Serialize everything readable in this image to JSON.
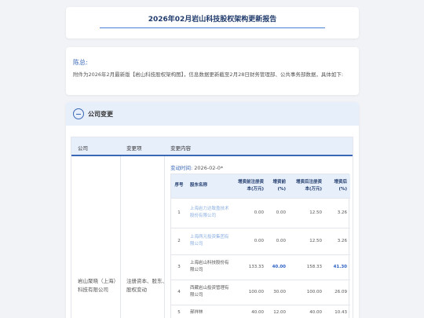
{
  "report": {
    "title": "2026年02月岩山科技股权架构更新报告"
  },
  "summary": {
    "label": "陈总:",
    "text": "附件为2026年2月最新版【岩山科技股权架构图】，信息数据更新截至2月28日财务管理部、公共事务部数据，具体如下:"
  },
  "section": {
    "label": "公司变更"
  },
  "table": {
    "col_company": "公司",
    "col_type": "变更项",
    "col_content": "变更内容",
    "company": "岩山聚晓（上海）科技有限公司",
    "change_type": "注册资本、股东、股权变动",
    "change_time_key": "变动时间:",
    "change_time_value": "2026-02-0*",
    "inner_headers": {
      "idx": "序号",
      "name": "股东名称",
      "before_capital": "增资前注册资本(万元)",
      "before_pct": "增资前(%)",
      "after_capital": "增资后注册资本(万元)",
      "after_pct": "增资后(%)"
    },
    "rows": [
      {
        "idx": "1",
        "name": "上海岩力达致盈技术股份有限公司",
        "before_capital": "0.00",
        "before_pct": "0.00",
        "after_capital": "12.50",
        "after_pct": "3.26"
      },
      {
        "idx": "2",
        "name": "上海两元投资集团有限公司",
        "before_capital": "0.00",
        "before_pct": "0.00",
        "after_capital": "12.50",
        "after_pct": "3.26"
      },
      {
        "idx": "3",
        "name": "上海岩山科技股份有限公司",
        "before_capital": "133.33",
        "before_pct": "40.00",
        "after_capital": "158.33",
        "after_pct": "41.30"
      },
      {
        "idx": "4",
        "name": "西藏岩山投资管理有限公司",
        "before_capital": "100.00",
        "before_pct": "30.00",
        "after_capital": "100.00",
        "after_pct": "26.09"
      },
      {
        "idx": "5",
        "name": "郝祥林",
        "before_capital": "40.00",
        "before_pct": "12.00",
        "after_capital": "40.00",
        "after_pct": "10.43"
      }
    ]
  },
  "colors": {
    "accent": "#3a68b7",
    "header_bg": "#e7effb",
    "highlight": "#2f63c4"
  }
}
